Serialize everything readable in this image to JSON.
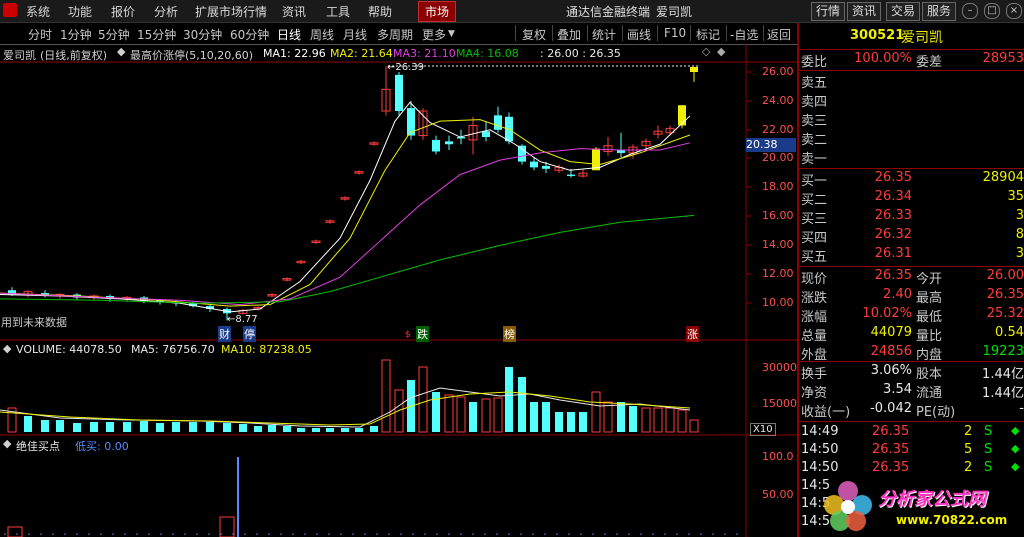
{
  "menu": {
    "items": [
      "系统",
      "功能",
      "报价",
      "分析",
      "扩展市场行情",
      "资讯",
      "工具",
      "帮助"
    ],
    "active": "市场",
    "title": "通达信金融终端",
    "stock_name": "爱司凯",
    "right_buttons": [
      "行情",
      "资讯",
      "交易",
      "服务"
    ]
  },
  "toolbar": {
    "periods": [
      "分时",
      "1分钟",
      "5分钟",
      "15分钟",
      "30分钟",
      "60分钟",
      "日线",
      "周线",
      "月线",
      "多周期",
      "更多"
    ],
    "selected": "日线",
    "tools": [
      "复权",
      "叠加",
      "统计",
      "画线",
      "F10",
      "标记",
      "-自选",
      "返回"
    ]
  },
  "price_chart": {
    "header_name": "爱司凯",
    "header_mode": "(日线,前复权)",
    "indicator": "最高价涨停(5,10,20,60)",
    "ma1": "MA1: 22.96",
    "ma2": "MA2: 21.64",
    "ma3": "MA3: 21.10",
    "ma4": "MA4: 16.08",
    "range": ": 26.00 : 26.35",
    "y_ticks": [
      "26.00",
      "24.00",
      "22.00",
      "20.00",
      "18.00",
      "16.00",
      "14.00",
      "12.00",
      "10.00"
    ],
    "cursor_value": "20.38",
    "high_label": "26.39",
    "low_label": "8.77",
    "future_label": "用到未来数据",
    "markers": [
      "财",
      "停",
      "跌",
      "榜",
      "涨"
    ],
    "colors": {
      "ma1": "#ffffff",
      "ma2": "#f0f000",
      "ma3": "#e040e0",
      "ma4": "#00c000",
      "up": "#ff3c3c",
      "down": "#54ffff"
    }
  },
  "volume_chart": {
    "label": "VOLUME: 44078.50",
    "ma5": "MA5: 76756.70",
    "ma10": "MA10: 87238.05",
    "y_ticks": [
      "30000",
      "15000"
    ],
    "unit": "X10"
  },
  "signal_chart": {
    "label": "绝佳买点",
    "sub": "低买: 0.00",
    "y_ticks": [
      "100.0",
      "50.00"
    ]
  },
  "quote": {
    "code": "300521",
    "name": "爱司凯",
    "webi_label": "委比",
    "webi_value": "100.00%",
    "weicha_label": "委差",
    "weicha_value": "28953",
    "sells": [
      {
        "label": "卖五",
        "price": "",
        "vol": ""
      },
      {
        "label": "卖四",
        "price": "",
        "vol": ""
      },
      {
        "label": "卖三",
        "price": "",
        "vol": ""
      },
      {
        "label": "卖二",
        "price": "",
        "vol": ""
      },
      {
        "label": "卖一",
        "price": "",
        "vol": ""
      }
    ],
    "buys": [
      {
        "label": "买一",
        "price": "26.35",
        "vol": "28904"
      },
      {
        "label": "买二",
        "price": "26.34",
        "vol": "35"
      },
      {
        "label": "买三",
        "price": "26.33",
        "vol": "3"
      },
      {
        "label": "买四",
        "price": "26.32",
        "vol": "8"
      },
      {
        "label": "买五",
        "price": "26.31",
        "vol": "3"
      }
    ],
    "stats1": [
      {
        "k": "现价",
        "v": "26.35",
        "k2": "今开",
        "v2": "26.00"
      },
      {
        "k": "涨跌",
        "v": "2.40",
        "k2": "最高",
        "v2": "26.35"
      },
      {
        "k": "涨幅",
        "v": "10.02%",
        "k2": "最低",
        "v2": "25.32"
      },
      {
        "k": "总量",
        "v": "44079",
        "k2": "量比",
        "v2": "0.54"
      },
      {
        "k": "外盘",
        "v": "24856",
        "k2": "内盘",
        "v2": "19223"
      }
    ],
    "stats2": [
      {
        "k": "换手",
        "v": "3.06%",
        "k2": "股本",
        "v2": "1.44亿"
      },
      {
        "k": "净资",
        "v": "3.54",
        "k2": "流通",
        "v2": "1.44亿"
      },
      {
        "k": "收益(一)",
        "v": "-0.042",
        "k2": "PE(动)",
        "v2": "-"
      }
    ],
    "ticks": [
      {
        "time": "14:49",
        "price": "26.35",
        "vol": "2",
        "bs": "S"
      },
      {
        "time": "14:50",
        "price": "26.35",
        "vol": "5",
        "bs": "S"
      },
      {
        "time": "14:50",
        "price": "26.35",
        "vol": "2",
        "bs": "S"
      },
      {
        "time": "14:5",
        "price": "",
        "vol": "",
        "bs": ""
      },
      {
        "time": "14:5",
        "price": "",
        "vol": "",
        "bs": ""
      },
      {
        "time": "14:5",
        "price": "",
        "vol": "",
        "bs": ""
      }
    ]
  },
  "watermark": {
    "text": "分析家公式网",
    "url": "www.70822.com"
  }
}
